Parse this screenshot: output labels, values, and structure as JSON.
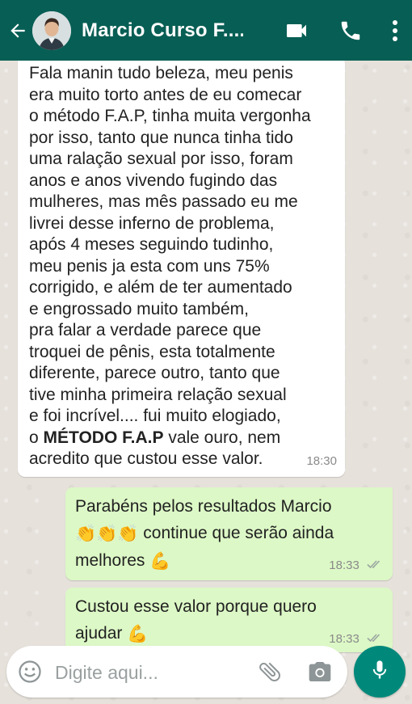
{
  "header": {
    "contact_name": "Marcio Curso F....",
    "icons": [
      "back-arrow-icon",
      "video-camera-icon",
      "phone-icon",
      "more-vert-icon"
    ]
  },
  "messages": [
    {
      "direction": "incoming",
      "text_before": "Fala manin tudo beleza, meu penis\nera muito torto antes de eu comecar\no método F.A.P, tinha muita vergonha\npor isso, tanto que nunca tinha tido\numa ralação sexual por isso, foram\nanos e anos vivendo fugindo das\nmulheres, mas mês passado eu me\nlivrei desse inferno de problema,\napós 4 meses seguindo tudinho,\nmeu penis ja esta com uns  75%\ncorrigido, e além de ter aumentado\ne engrossado muito também,\npra falar a verdade parece que\ntroquei de pênis, esta totalmente\ndiferente, parece outro, tanto que\ntive minha primeira relação sexual\ne foi incrível.... fui muito elogiado,\no ",
      "bold_text": "MÉTODO F.A.P",
      "text_after": "  vale ouro, nem\nacredito que custou esse valor.",
      "time": "18:30"
    },
    {
      "direction": "outgoing",
      "line1": "Parabéns pelos resultados Marcio",
      "emoji_clap": "👏👏👏",
      "line2": " continue que serão ainda",
      "line3": "melhores ",
      "emoji_muscle": "💪",
      "time": "18:33",
      "status": "read-double-check"
    },
    {
      "direction": "outgoing",
      "line1": "Custou esse valor porque quero",
      "line2": "ajudar ",
      "emoji_muscle": "💪",
      "time": "18:33",
      "status": "read-double-check"
    }
  ],
  "composer": {
    "placeholder": "Digite aqui...",
    "icons": [
      "emoji-icon",
      "attach-icon",
      "camera-icon",
      "mic-icon"
    ]
  },
  "colors": {
    "header": "#075e54",
    "outgoing_bubble": "#dcf8c6",
    "incoming_bubble": "#ffffff",
    "mic_button": "#00897b"
  }
}
